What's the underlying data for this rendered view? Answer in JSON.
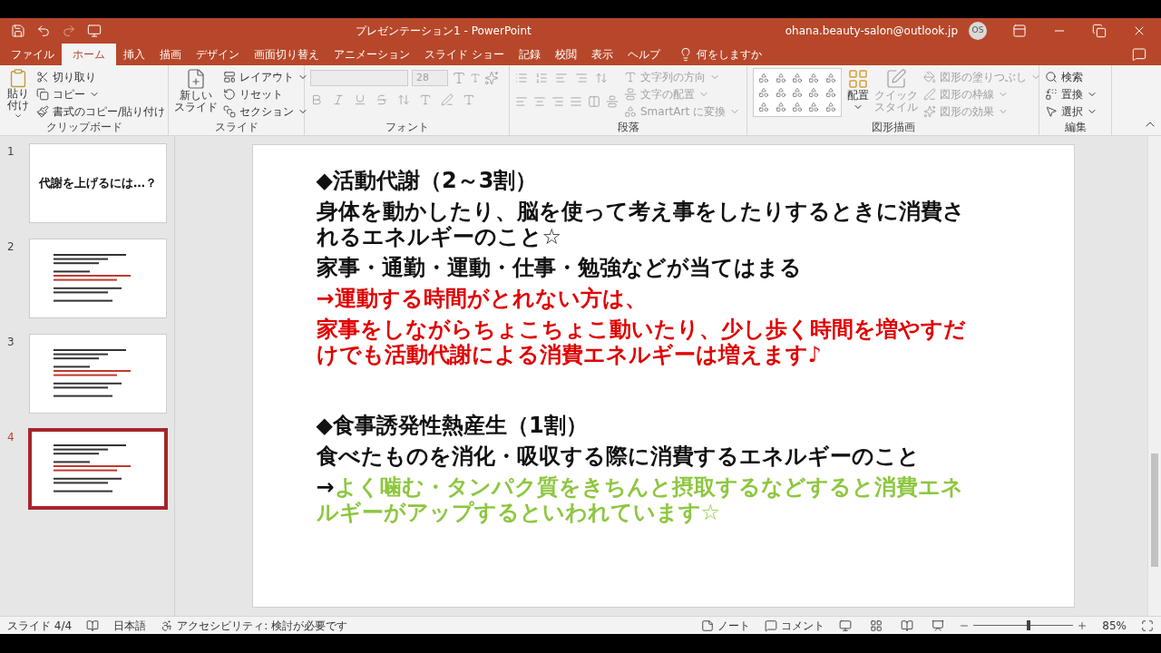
{
  "window": {
    "title": "プレゼンテーション1  -  PowerPoint",
    "account": "ohana.beauty-salon@outlook.jp",
    "avatar": "OS"
  },
  "tabs": [
    {
      "label": "ファイル",
      "selected": false
    },
    {
      "label": "ホーム",
      "selected": true
    },
    {
      "label": "挿入",
      "selected": false
    },
    {
      "label": "描画",
      "selected": false
    },
    {
      "label": "デザイン",
      "selected": false
    },
    {
      "label": "画面切り替え",
      "selected": false
    },
    {
      "label": "アニメーション",
      "selected": false
    },
    {
      "label": "スライド ショー",
      "selected": false
    },
    {
      "label": "記録",
      "selected": false
    },
    {
      "label": "校閲",
      "selected": false
    },
    {
      "label": "表示",
      "selected": false
    },
    {
      "label": "ヘルプ",
      "selected": false
    }
  ],
  "tell_me": "何をしますか",
  "ribbon": {
    "clipboard": {
      "label": "クリップボード",
      "paste": "貼り付け",
      "items": [
        {
          "label": "切り取り"
        },
        {
          "label": "コピー"
        },
        {
          "label": "書式のコピー/貼り付け"
        }
      ]
    },
    "slides": {
      "label": "スライド",
      "new_slide": [
        "新しい",
        "スライド"
      ],
      "items": [
        {
          "label": "レイアウト"
        },
        {
          "label": "リセット"
        },
        {
          "label": "セクション"
        }
      ]
    },
    "font": {
      "label": "フォント",
      "size": "28",
      "disabled": true
    },
    "paragraph": {
      "label": "段落",
      "items": [
        {
          "label": "文字列の方向",
          "disabled": true
        },
        {
          "label": "文字の配置",
          "disabled": true
        },
        {
          "label": "SmartArt に変換",
          "disabled": true
        }
      ]
    },
    "drawing": {
      "label": "図形描画",
      "arrange": "配置",
      "quick_style": [
        "クイック",
        "スタイル"
      ],
      "items": [
        {
          "label": "図形の塗りつぶし",
          "disabled": true
        },
        {
          "label": "図形の枠線",
          "disabled": true
        },
        {
          "label": "図形の効果",
          "disabled": true
        }
      ]
    },
    "editing": {
      "label": "編集",
      "items": [
        {
          "label": "検索"
        },
        {
          "label": "置換"
        },
        {
          "label": "選択"
        }
      ]
    }
  },
  "slides": [
    {
      "number": "1",
      "title": "代謝を上げるには…？",
      "selected": false
    },
    {
      "number": "2",
      "selected": false
    },
    {
      "number": "3",
      "selected": false
    },
    {
      "number": "4",
      "selected": true
    }
  ],
  "slide": {
    "sections": [
      {
        "lines": [
          {
            "kind": "heading",
            "text": "◆活動代謝（2～3割）"
          },
          {
            "kind": "body",
            "text": "身体を動かしたり、脳を使って考え事をしたりするときに消費されるエネルギーのこと☆"
          },
          {
            "kind": "body",
            "text": "家事・通勤・運動・仕事・勉強などが当てはまる"
          },
          {
            "kind": "red",
            "text": "→運動する時間がとれない方は、"
          },
          {
            "kind": "red",
            "text": "家事をしながらちょこちょこ動いたり、少し歩く時間を増やすだけでも活動代謝による消費エネルギーは増えます♪"
          }
        ]
      },
      {
        "lines": [
          {
            "kind": "heading",
            "text": "◆食事誘発性熱産生（1割）"
          },
          {
            "kind": "body",
            "text": "食べたものを消化・吸収する際に消費するエネルギーのこと"
          },
          {
            "kind": "green",
            "prefix": "→",
            "text": "よく噛む・タンパク質をきちんと摂取するなどすると消費エネルギーがアップするといわれています☆"
          }
        ]
      }
    ]
  },
  "status": {
    "slide": "スライド 4/4",
    "language": "日本語",
    "accessibility": "アクセシビリティ: 検討が必要です",
    "notes": "ノート",
    "comments": "コメント",
    "zoom": "85%",
    "zoom_slider": {
      "level": 0.55
    }
  }
}
